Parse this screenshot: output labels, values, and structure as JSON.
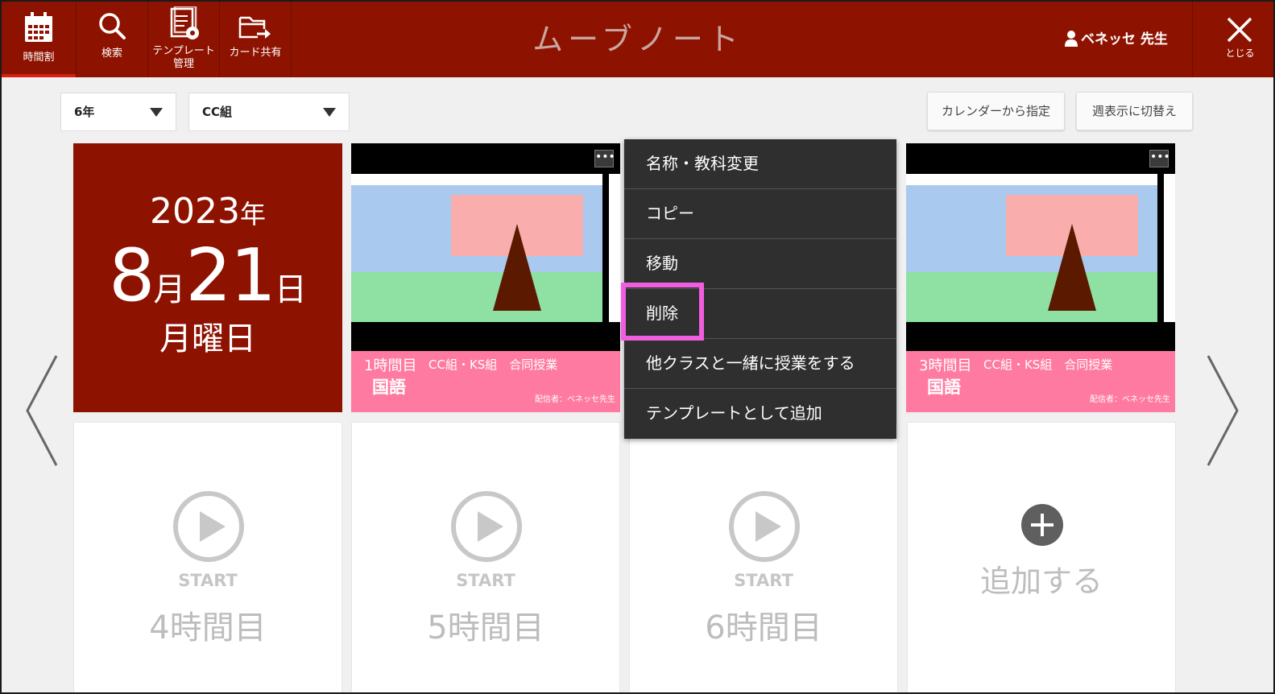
{
  "header": {
    "nav": [
      {
        "label": "時間割",
        "icon": "calendar-icon"
      },
      {
        "label": "検索",
        "icon": "search-icon"
      },
      {
        "label_line1": "テンプレート",
        "label_line2": "管理",
        "icon": "template-settings-icon"
      },
      {
        "label": "カード共有",
        "icon": "folder-share-icon"
      }
    ],
    "app_title": "ムーブノート",
    "user_name": "ベネッセ 先生",
    "close_label": "とじる"
  },
  "toolbar": {
    "grade_select": "6年",
    "class_select": "CC組",
    "calendar_button": "カレンダーから指定",
    "week_button": "週表示に切替え"
  },
  "date": {
    "year": "2023",
    "year_unit": "年",
    "month": "8",
    "month_unit": "月",
    "day": "21",
    "day_unit": "日",
    "weekday": "月曜日"
  },
  "cards": [
    {
      "period": "1時間目",
      "classes": "CC組・KS組　合同授業",
      "subject": "国語",
      "owner": "配信者：ベネッセ先生",
      "more": "•••"
    },
    {
      "period": "3時間目",
      "classes": "CC組・KS組　合同授業",
      "subject": "国語",
      "owner": "配信者：ベネッセ先生",
      "more": "•••"
    }
  ],
  "slots": [
    {
      "start": "START",
      "period": "4時間目"
    },
    {
      "start": "START",
      "period": "5時間目"
    },
    {
      "start": "START",
      "period": "6時間目"
    }
  ],
  "add_slot": {
    "label": "追加する"
  },
  "context_menu": {
    "items": [
      "名称・教科変更",
      "コピー",
      "移動",
      "削除",
      "他クラスと一緒に授業をする",
      "テンプレートとして追加"
    ]
  },
  "colors": {
    "header_bg": "#8e1200",
    "card_info_bg": "#ff7aa0",
    "highlight": "#f05ee0",
    "menu_bg": "#2f2f2f"
  }
}
